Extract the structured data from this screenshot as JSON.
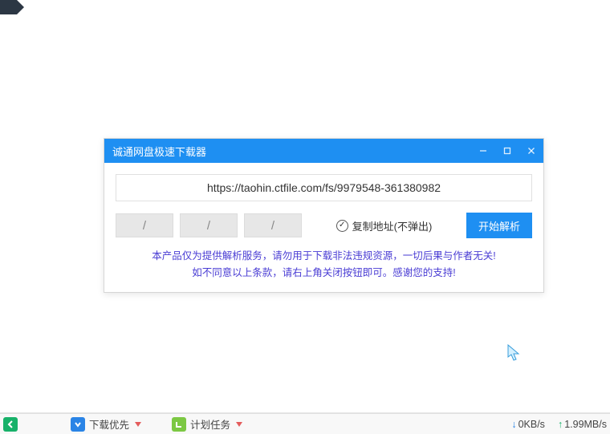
{
  "dialog": {
    "title": "诚通网盘极速下载器",
    "url_value": "https://taohin.ctfile.com/fs/9979548-361380982",
    "slots": [
      "/",
      "/",
      "/"
    ],
    "checkbox_label": "复制地址(不弹出)",
    "parse_label": "开始解析",
    "disclaimer_line1": "本产品仅为提供解析服务，请勿用于下载非法违规资源，一切后果与作者无关!",
    "disclaimer_line2": "如不同意以上条款，请右上角关闭按钮即可。感谢您的支持!"
  },
  "statusbar": {
    "download_priority": "下载优先",
    "scheduled_task": "计划任务",
    "down_speed": "0KB/s",
    "up_speed": "1.99MB/s"
  }
}
